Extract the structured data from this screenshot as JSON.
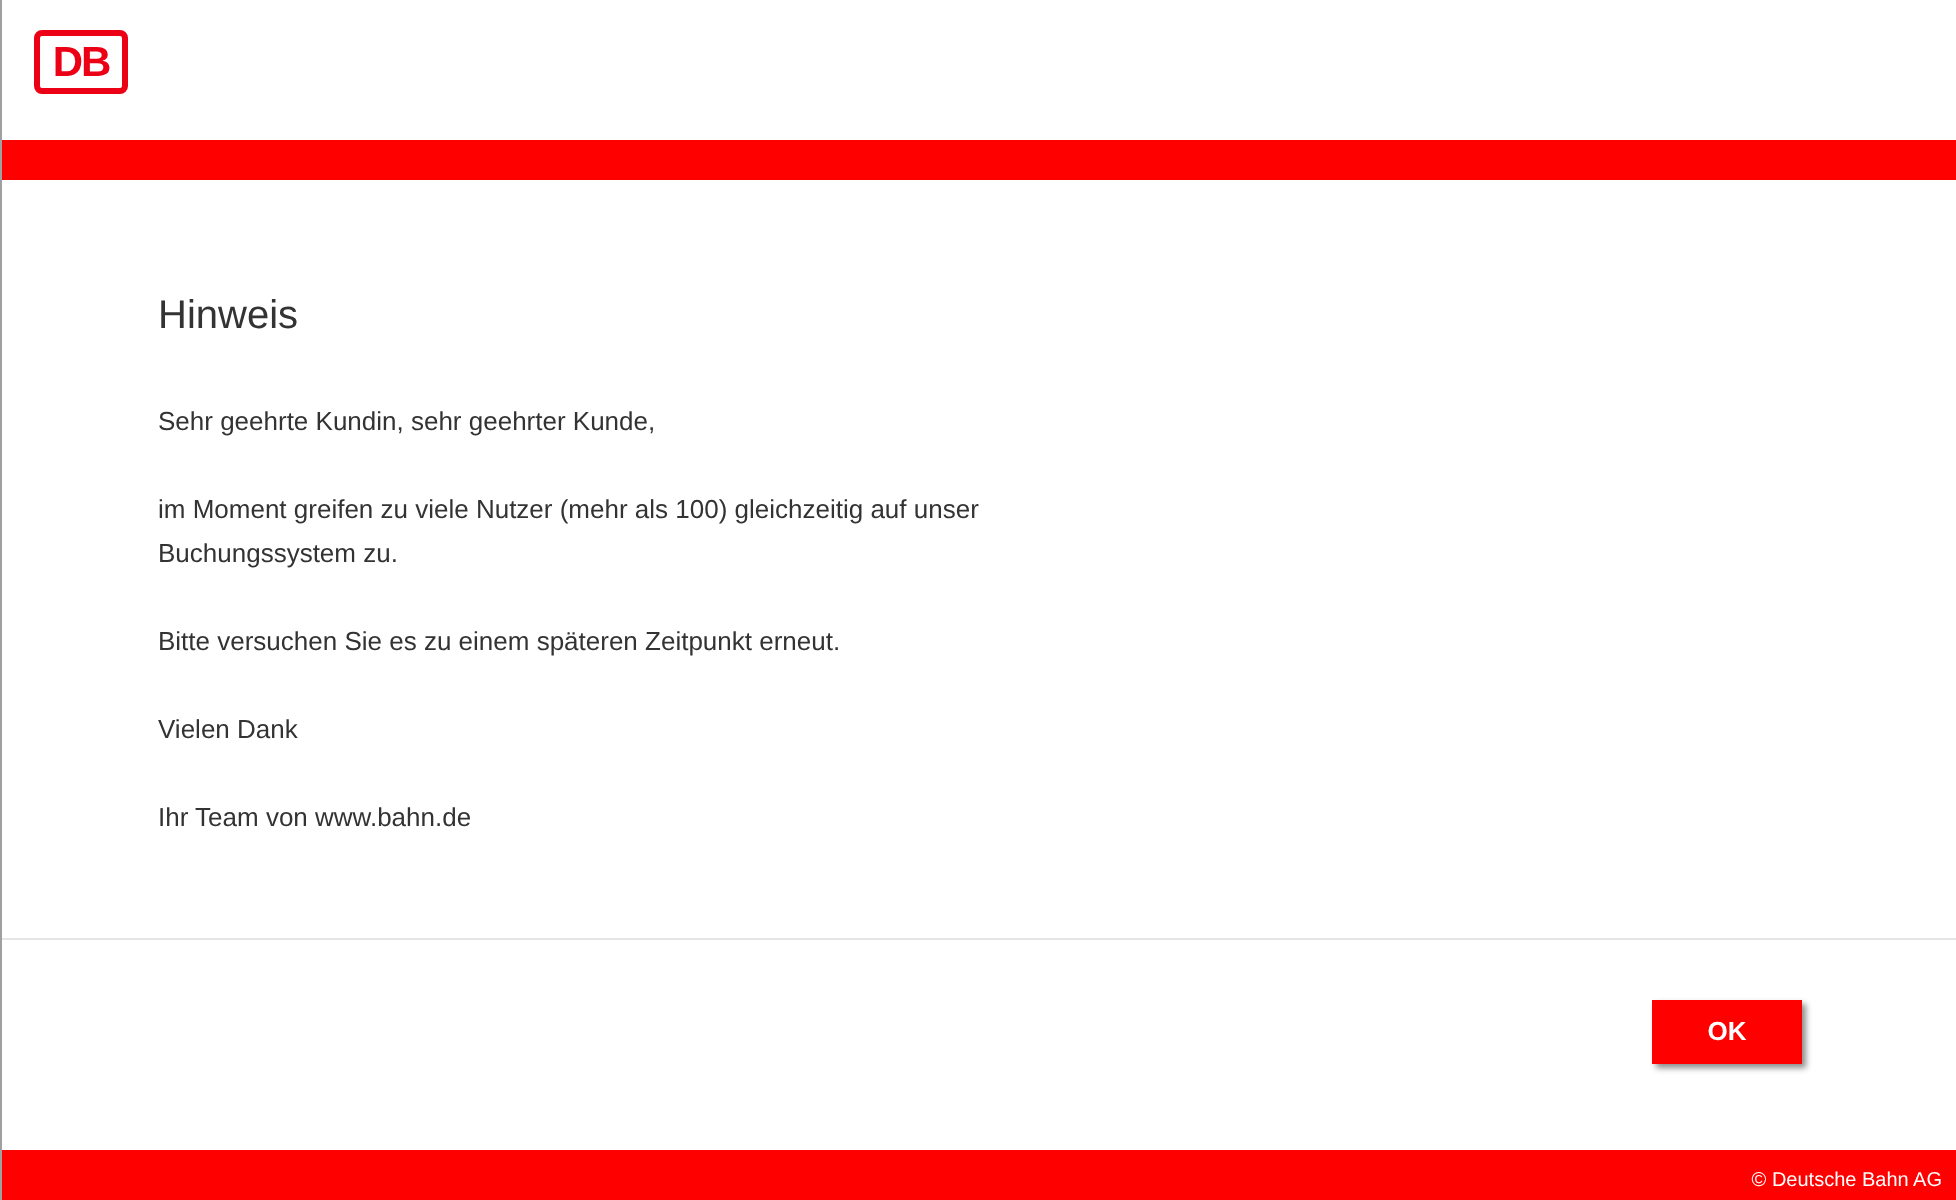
{
  "logo": {
    "text": "DB"
  },
  "dialog": {
    "title": "Hinweis",
    "paragraphs": [
      "Sehr geehrte Kundin, sehr geehrter Kunde,",
      "im Moment greifen zu viele Nutzer (mehr als 100) gleichzeitig auf unser Buchungssystem zu.",
      "Bitte versuchen Sie es zu einem späteren Zeitpunkt erneut.",
      "Vielen Dank",
      "Ihr Team von www.bahn.de"
    ],
    "buttons": [
      {
        "label": "OK"
      }
    ]
  },
  "footer": {
    "copyright": "© Deutsche Bahn AG"
  }
}
